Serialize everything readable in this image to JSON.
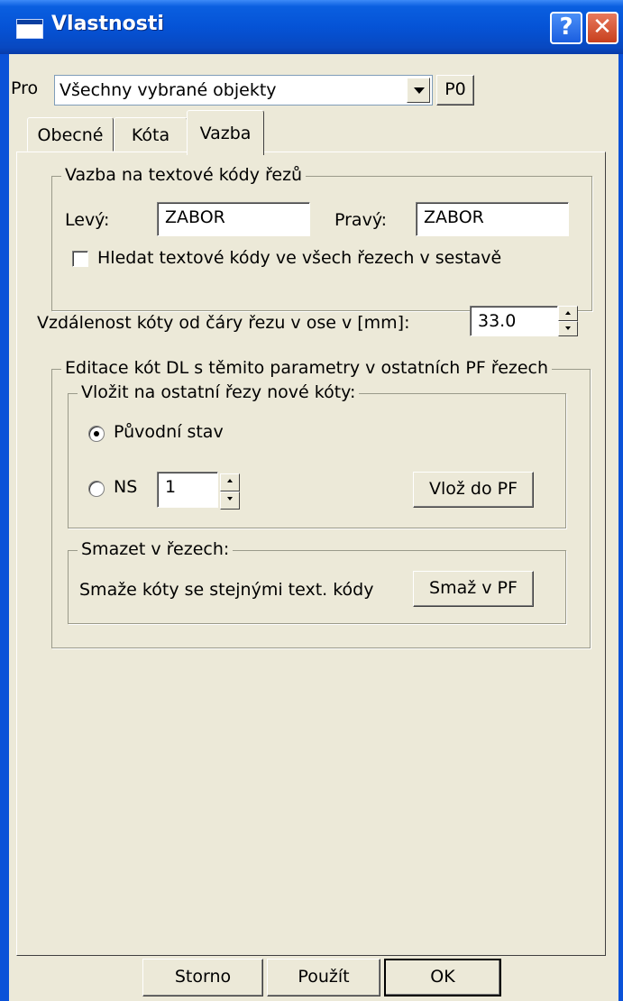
{
  "window": {
    "title": "Vlastnosti"
  },
  "titlebar": {
    "help_glyph": "?",
    "close_glyph": "✕"
  },
  "pro": {
    "label": "Pro",
    "selected": "Všechny vybrané objekty",
    "button": "P0"
  },
  "tabs": [
    {
      "label": "Obecné",
      "active": false
    },
    {
      "label": "Kóta",
      "active": false
    },
    {
      "label": "Vazba",
      "active": true
    }
  ],
  "vazba_group": {
    "title": "Vazba na textové kódy řezů",
    "levy_label": "Levý:",
    "levy_value": "ZABOR",
    "pravy_label": "Pravý:",
    "pravy_value": "ZABOR",
    "search_checkbox_label": "Hledat textové kódy ve všech řezech v sestavě",
    "search_checked": false
  },
  "distance": {
    "label": "Vzdálenost kóty od čáry řezu v ose v [mm]:",
    "value": "33.0"
  },
  "edit_group": {
    "title": "Editace kót DL s těmito parametry v ostatních PF řezech",
    "insert_group": {
      "title": "Vložit na ostatní řezy nové kóty:",
      "radio_original": "Původní stav",
      "radio_ns": "NS",
      "ns_value": "1",
      "insert_button": "Vlož do PF",
      "selected": "Původní stav"
    },
    "delete_group": {
      "title": "Smazet v řezech:",
      "description": "Smaže kóty se stejnými text. kódy",
      "delete_button": "Smaž v PF"
    }
  },
  "footer": {
    "cancel": "Storno",
    "apply": "Použít",
    "ok": "OK"
  }
}
